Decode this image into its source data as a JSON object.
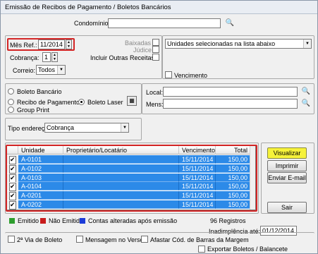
{
  "window": {
    "title": "Emissão de Recibos de Pagamento / Boletos Bancários"
  },
  "condominio": {
    "label": "Condomínio:",
    "value": ""
  },
  "filters": {
    "mes_ref_label": "Mês Ref.:",
    "mes_ref_value": "11/2014",
    "cobranca_label": "Cobrança:",
    "cobranca_value": "1",
    "correio_label": "Correio:",
    "correio_value": "Todos",
    "baixadas_label": "Baixadas",
    "judice_label": "Júdice",
    "incluir_label": "Incluir Outras Receitas"
  },
  "unidades": {
    "selected": "Unidades selecionadas na lista abaixo",
    "vencimento_label": "Vencimento"
  },
  "tipo_emissao": {
    "boleto_bancario": "Boleto Bancário",
    "recibo_pagamento": "Recibo de Pagamento",
    "boleto_laser": "Boleto Laser",
    "group_print": "Group Print"
  },
  "local": {
    "local_label": "Local:",
    "local_value": "",
    "mens_label": "Mens:",
    "mens_value": ""
  },
  "endereco": {
    "label": "Tipo endereço:",
    "value": "Cobrança"
  },
  "grid": {
    "headers": [
      "Unidade",
      "Proprietário/Locatário",
      "Vencimento",
      "Total"
    ],
    "rows": [
      {
        "unidade": "A-0101",
        "prop": "",
        "venc": "15/11/2014",
        "total": "150,00"
      },
      {
        "unidade": "A-0102",
        "prop": "",
        "venc": "15/11/2014",
        "total": "150,00"
      },
      {
        "unidade": "A-0103",
        "prop": "",
        "venc": "15/11/2014",
        "total": "150,00"
      },
      {
        "unidade": "A-0104",
        "prop": "",
        "venc": "15/11/2014",
        "total": "150,00"
      },
      {
        "unidade": "A-0201",
        "prop": "",
        "venc": "15/11/2014",
        "total": "150,00"
      },
      {
        "unidade": "A-0202",
        "prop": "",
        "venc": "15/11/2014",
        "total": "150,00"
      }
    ]
  },
  "buttons": {
    "visualizar": "Visualizar",
    "imprimir": "Imprimir",
    "enviar_email": "Enviar E-mail",
    "sair": "Sair"
  },
  "legend": {
    "emitido": "Emitido",
    "nao_emitido": "Não Emitido",
    "alteradas": "Contas alteradas após emissão",
    "registros": "96 Registros"
  },
  "inadimplencia": {
    "label": "Inadimplência até:",
    "value": "01/12/2014"
  },
  "options": {
    "segunda_via": "2ª Via de Boleto",
    "mensagem_verso": "Mensagem no Verso",
    "afastar_cod": "Afastar Cód. de Barras da Margem",
    "exportar": "Exportar Boletos / Balancete"
  },
  "colors": {
    "selection": "#2c8ae8",
    "highlight_red": "#d32525",
    "visualizar_bg": "#f6f23a",
    "legend_green": "#2e9e2e",
    "legend_red": "#c81c1c",
    "legend_blue": "#1c3cd8"
  }
}
